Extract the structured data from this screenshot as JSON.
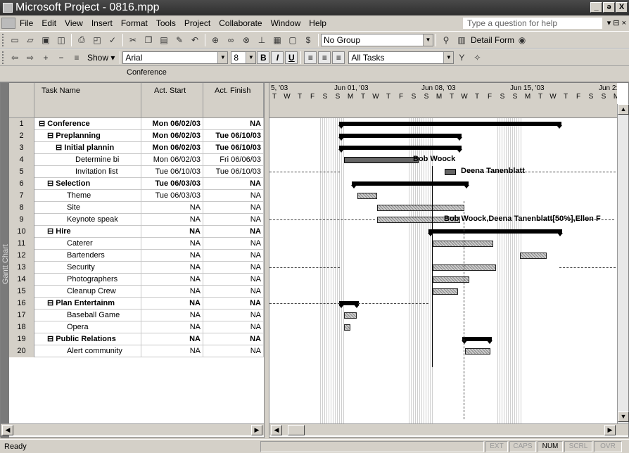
{
  "window": {
    "title": "Microsoft Project - 0816.mpp",
    "buttons": [
      "_",
      "ə",
      "X"
    ]
  },
  "menu": [
    "File",
    "Edit",
    "View",
    "Insert",
    "Format",
    "Tools",
    "Project",
    "Collaborate",
    "Window",
    "Help"
  ],
  "help_placeholder": "Type a question for help",
  "toolbar1": {
    "group": "No Group",
    "detail_form": "Detail Form"
  },
  "toolbar2": {
    "show": "Show ▾",
    "font": "Arial",
    "size": "8",
    "filter": "All Tasks"
  },
  "entry_value": "Conference",
  "view_label": "Gantt Chart",
  "columns": {
    "name": "Task Name",
    "start": "Act. Start",
    "finish": "Act. Finish"
  },
  "timescale": {
    "weeks": [
      "5, '03",
      "Jun 01, '03",
      "Jun 08, '03",
      "Jun 15, '03",
      "Jun 2:"
    ],
    "days": [
      "T",
      "W",
      "T",
      "F",
      "S",
      "S",
      "M",
      "T",
      "W",
      "T",
      "F",
      "S",
      "S",
      "M",
      "T",
      "W",
      "T",
      "F",
      "S",
      "S",
      "M",
      "T",
      "W",
      "T",
      "F",
      "S",
      "S",
      "M"
    ]
  },
  "tasks": [
    {
      "id": "1",
      "name": "⊟ Conference",
      "start": "Mon 06/02/03",
      "finish": "NA",
      "bold": true,
      "indent": 0
    },
    {
      "id": "2",
      "name": "⊟ Preplanning",
      "start": "Mon 06/02/03",
      "finish": "Tue 06/10/03",
      "bold": true,
      "indent": 1
    },
    {
      "id": "3",
      "name": "⊟ Initial plannin",
      "start": "Mon 06/02/03",
      "finish": "Tue 06/10/03",
      "bold": true,
      "indent": 2
    },
    {
      "id": "4",
      "name": "Determine bi",
      "start": "Mon 06/02/03",
      "finish": "Fri 06/06/03",
      "bold": false,
      "indent": 3
    },
    {
      "id": "5",
      "name": "Invitation list",
      "start": "Tue 06/10/03",
      "finish": "Tue 06/10/03",
      "bold": false,
      "indent": 3
    },
    {
      "id": "6",
      "name": "⊟ Selection",
      "start": "Tue 06/03/03",
      "finish": "NA",
      "bold": true,
      "indent": 1
    },
    {
      "id": "7",
      "name": "Theme",
      "start": "Tue 06/03/03",
      "finish": "NA",
      "bold": false,
      "indent": 2
    },
    {
      "id": "8",
      "name": "Site",
      "start": "NA",
      "finish": "NA",
      "bold": false,
      "indent": 2
    },
    {
      "id": "9",
      "name": "Keynote speak",
      "start": "NA",
      "finish": "NA",
      "bold": false,
      "indent": 2
    },
    {
      "id": "10",
      "name": "⊟ Hire",
      "start": "NA",
      "finish": "NA",
      "bold": true,
      "indent": 1
    },
    {
      "id": "11",
      "name": "Caterer",
      "start": "NA",
      "finish": "NA",
      "bold": false,
      "indent": 2
    },
    {
      "id": "12",
      "name": "Bartenders",
      "start": "NA",
      "finish": "NA",
      "bold": false,
      "indent": 2
    },
    {
      "id": "13",
      "name": "Security",
      "start": "NA",
      "finish": "NA",
      "bold": false,
      "indent": 2
    },
    {
      "id": "14",
      "name": "Photographers",
      "start": "NA",
      "finish": "NA",
      "bold": false,
      "indent": 2
    },
    {
      "id": "15",
      "name": "Cleanup Crew",
      "start": "NA",
      "finish": "NA",
      "bold": false,
      "indent": 2
    },
    {
      "id": "16",
      "name": "⊟ Plan Entertainm",
      "start": "NA",
      "finish": "NA",
      "bold": true,
      "indent": 1
    },
    {
      "id": "17",
      "name": "Baseball Game",
      "start": "NA",
      "finish": "NA",
      "bold": false,
      "indent": 2
    },
    {
      "id": "18",
      "name": "Opera",
      "start": "NA",
      "finish": "NA",
      "bold": false,
      "indent": 2
    },
    {
      "id": "19",
      "name": "⊟ Public Relations",
      "start": "NA",
      "finish": "NA",
      "bold": true,
      "indent": 1
    },
    {
      "id": "20",
      "name": "Alert community",
      "start": "NA",
      "finish": "NA",
      "bold": false,
      "indent": 2
    }
  ],
  "resources": {
    "t4": "Bob Woock",
    "t5": "Deena Tanenblatt",
    "t9": "Bob Woock,Deena Tanenblatt[50%],Ellen F"
  },
  "status": {
    "text": "Ready",
    "indicators": [
      "EXT",
      "CAPS",
      "NUM",
      "SCRL",
      "OVR"
    ],
    "active": "NUM"
  }
}
